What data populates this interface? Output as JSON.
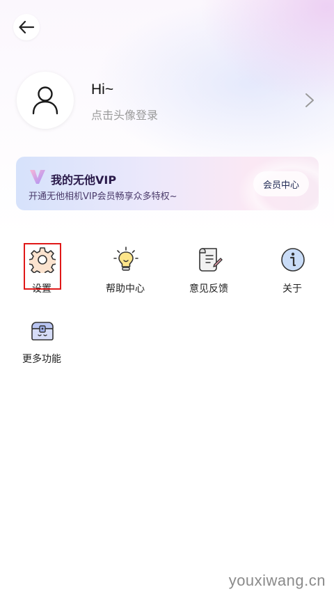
{
  "header": {
    "back_icon": "arrow-left-icon"
  },
  "profile": {
    "greeting": "Hi~",
    "login_hint": "点击头像登录",
    "avatar_icon": "user-icon",
    "chevron_icon": "chevron-right-icon"
  },
  "vip": {
    "title": "我的无他VIP",
    "description": "开通无他相机VIP会员畅享众多特权~",
    "button_label": "会员中心",
    "logo_icon": "v-logo-icon"
  },
  "menu": [
    {
      "label": "设置",
      "icon": "gear-icon"
    },
    {
      "label": "帮助中心",
      "icon": "lightbulb-icon"
    },
    {
      "label": "意见反馈",
      "icon": "feedback-scroll-icon"
    },
    {
      "label": "关于",
      "icon": "info-icon"
    },
    {
      "label": "更多功能",
      "icon": "treasure-chest-icon"
    }
  ],
  "watermark": "youxiwang.cn",
  "colors": {
    "highlight": "#e01818",
    "hint_text": "#9a9a9a"
  }
}
